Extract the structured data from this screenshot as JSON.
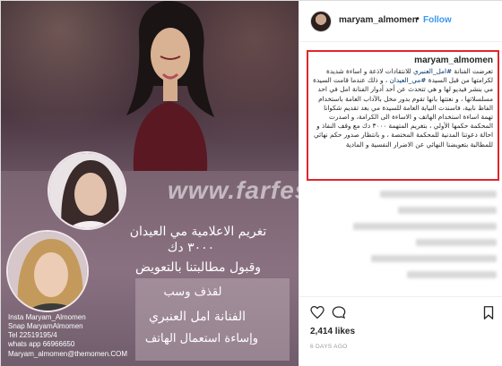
{
  "post_image": {
    "watermark": "www.farfesh.com",
    "headline_line1": "تغريم الاعلامية مي العيدان",
    "headline_line2": "٣٠٠٠ دك",
    "headline_line3": "وقبول مطالبتنا بالتعويض",
    "box_line1": "لقذف وسب",
    "box_line2": "الفنانة امل العنبري",
    "box_line3": "وإساءة استعمال الهاتف",
    "contact_lines": [
      "Insta Maryam_Almomen",
      "Snap MaryamAlmomen",
      "Tel 22519195/4",
      "whats app 66966650",
      "Maryam_almomen@themomen.COM"
    ]
  },
  "header": {
    "username": "maryam_almomen",
    "separator": "•",
    "follow_label": "Follow"
  },
  "caption": {
    "username": "maryam_almomen",
    "text_before_hashtag1": "تعرضت الفنانة ",
    "hashtag1": "#امل_العنبري",
    "text_mid": " للانتقادات لاذعة و اساءة شديدة لكرامتها من قبل السيدة ",
    "hashtag2": "#مي_العيدان",
    "text_after": " ، و ذلك عندما قامت السيدة مي بنشر فيديو لها و هي تتحدث عن أحد أدوار الفنانة امل في احد مسلسلاتها ، و نعتتها بانها تقوم بدور مخل بالآداب العامة باستخدام الفاظ نابية، فاسندت النيابة العامة للسيدة مي بعد تقديم شكوانا تهمة اساءة استخدام الهاتف و الاساءة الى الكرامة، و اصدرت المحكمة حكمها الأولي ، بتغريم المتهمة ٣٠٠٠ دك مع وقف النفاذ و احالة دعوتنا المدنية للمحكمة المختصة ، و بانتظار صدور حكم نهائي للمطالبة بتعويضنا النهائي عن الاضرار النفسية و المادية"
  },
  "engagement": {
    "likes": "2,414 likes",
    "date": "6 DAYS AGO"
  },
  "icons": {
    "like": "heart-icon",
    "comment": "comment-icon",
    "save": "bookmark-icon"
  },
  "colors": {
    "follow_blue": "#3897f0",
    "highlight_red": "#e0262b",
    "hashtag": "#003569"
  }
}
